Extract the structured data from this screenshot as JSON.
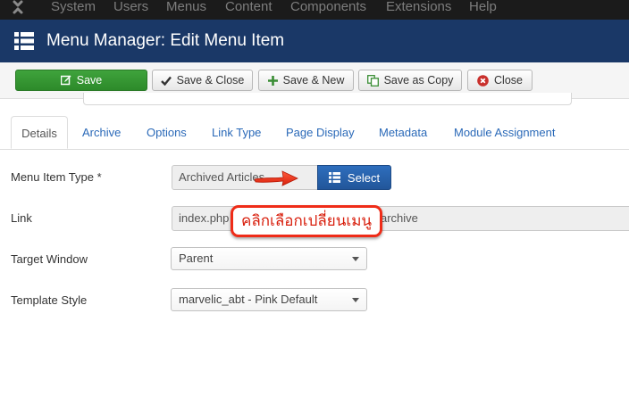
{
  "topnav": {
    "logo_icon": "joomla-logo-icon",
    "items": [
      "System",
      "Users",
      "Menus",
      "Content",
      "Components",
      "Extensions",
      "Help"
    ]
  },
  "header": {
    "icon": "list-menu-icon",
    "title": "Menu Manager: Edit Menu Item"
  },
  "toolbar": {
    "save": "Save",
    "save_close": "Save & Close",
    "save_new": "Save & New",
    "save_copy": "Save as Copy",
    "close": "Close"
  },
  "tabs": [
    "Details",
    "Archive",
    "Options",
    "Link Type",
    "Page Display",
    "Metadata",
    "Module Assignment"
  ],
  "form": {
    "menu_item_type": {
      "label": "Menu Item Type *",
      "value": "Archived Articles",
      "select_label": "Select"
    },
    "link": {
      "label": "Link",
      "value_start": "index.php",
      "value_end": "archive"
    },
    "target_window": {
      "label": "Target Window",
      "selected": "Parent"
    },
    "template_style": {
      "label": "Template Style",
      "selected": "marvelic_abt - Pink Default"
    }
  },
  "annotation": {
    "text": "คลิกเลือกเปลี่ยนเมนู",
    "color": "#ef2c18"
  },
  "colors": {
    "header_bg": "#1a3867",
    "save_green": "#3fa33c",
    "select_blue": "#2e6ebd",
    "link_blue": "#2a69b8"
  }
}
